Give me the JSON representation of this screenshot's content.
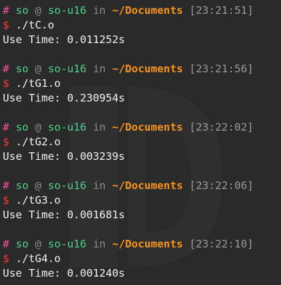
{
  "prompt": {
    "hash": "#",
    "at": "@",
    "in": "in",
    "user": "so",
    "host": "so-u16",
    "cwd": "~/Documents",
    "dollar": "$"
  },
  "entries": [
    {
      "time": "[23:21:51]",
      "command": "./tC.o",
      "output": "Use Time: 0.011252s"
    },
    {
      "time": "[23:21:56]",
      "command": "./tG1.o",
      "output": "Use Time: 0.230954s"
    },
    {
      "time": "[23:22:02]",
      "command": "./tG2.o",
      "output": "Use Time: 0.003239s"
    },
    {
      "time": "[23:22:06]",
      "command": "./tG3.o",
      "output": "Use Time: 0.001681s"
    },
    {
      "time": "[23:22:10]",
      "command": "./tG4.o",
      "output": "Use Time: 0.001240s"
    }
  ],
  "colors": {
    "background": "#2a2a2a",
    "hash": "#ff4fa0",
    "user_host": "#4fd18e",
    "cwd": "#f7941e",
    "dollar": "#ff3b30",
    "text": "#f2f2f2",
    "muted": "#8a8a8a"
  }
}
